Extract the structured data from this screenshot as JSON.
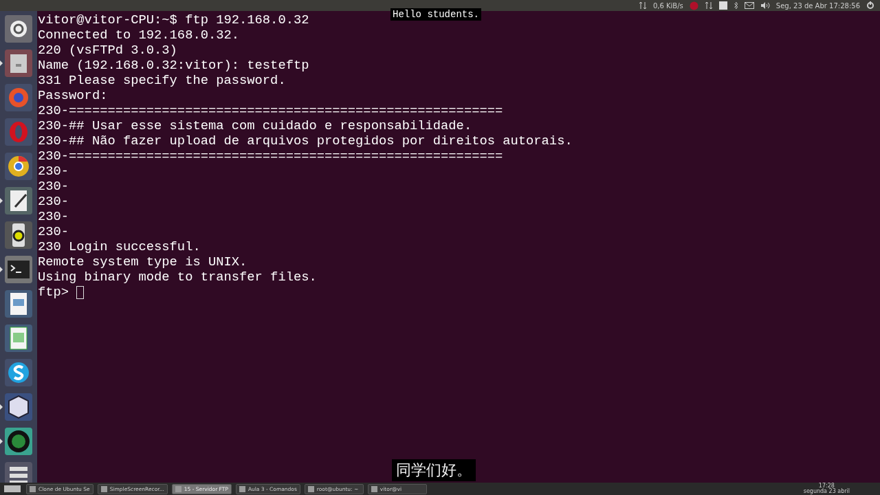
{
  "top_bar": {
    "network_speed": "0,6 KiB/s",
    "clock": "Seg, 23 de Abr 17:28:56"
  },
  "launcher": [
    {
      "running": false
    },
    {
      "running": true
    },
    {
      "running": false
    },
    {
      "running": false
    },
    {
      "running": false
    },
    {
      "running": true
    },
    {
      "running": false
    },
    {
      "running": true
    },
    {
      "running": false
    },
    {
      "running": false
    },
    {
      "running": false
    },
    {
      "running": true
    },
    {
      "running": true
    },
    {
      "running": false
    }
  ],
  "terminal": {
    "lines": [
      "vitor@vitor-CPU:~$ ftp 192.168.0.32",
      "Connected to 192.168.0.32.",
      "220 (vsFTPd 3.0.3)",
      "Name (192.168.0.32:vitor): testeftp",
      "331 Please specify the password.",
      "Password:",
      "230-========================================================",
      "230-## Usar esse sistema com cuidado e responsabilidade.",
      "230-## Não fazer upload de arquivos protegidos por direitos autorais.",
      "230-========================================================",
      "230-",
      "230-",
      "230-",
      "230-",
      "230-",
      "230 Login successful.",
      "Remote system type is UNIX.",
      "Using binary mode to transfer files."
    ],
    "prompt": "ftp>"
  },
  "subtitles": {
    "english": "Hello students.",
    "chinese": "同学们好。"
  },
  "taskbar": {
    "items": [
      {
        "label": "Clone de Ubuntu Se",
        "selected": false
      },
      {
        "label": "SimpleScreenRecor...",
        "selected": false
      },
      {
        "label": "15 - Servidor FTP",
        "selected": true
      },
      {
        "label": "Aula 3 - Comandos",
        "selected": false
      },
      {
        "label": "root@ubuntu: ~",
        "selected": false
      },
      {
        "label": "vitor@vi",
        "selected": false
      }
    ],
    "time": "17:28",
    "date": "segunda 23 abril"
  }
}
